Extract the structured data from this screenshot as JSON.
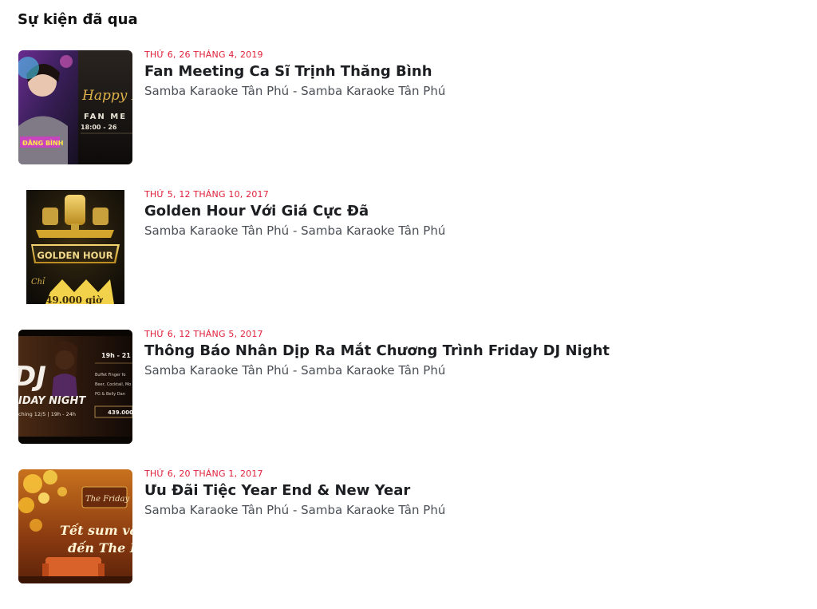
{
  "section": {
    "title": "Sự kiện đã qua"
  },
  "events": [
    {
      "date": "THỨ 6, 26 THÁNG 4, 2019",
      "title": "Fan Meeting Ca Sĩ Trịnh Thăng Bình",
      "location": "Samba Karaoke Tân Phú - Samba Karaoke Tân Phú",
      "thumb": {
        "line1": "Happy B",
        "line2": "FAN ME",
        "line3": "18:00 - 26",
        "tag": "ĐĂNG BÌNH"
      }
    },
    {
      "date": "THỨ 5, 12 THÁNG 10, 2017",
      "title": "Golden Hour Với Giá Cực Đã",
      "location": "Samba Karaoke Tân Phú - Samba Karaoke Tân Phú",
      "thumb": {
        "banner": "GOLDEN HOUR",
        "prefix": "Chỉ",
        "price": "49.000 giờ"
      }
    },
    {
      "date": "THỨ 6, 12 THÁNG 5, 2017",
      "title": "Thông Báo Nhân Dịp Ra Mắt Chương Trình Friday DJ Night",
      "location": "Samba Karaoke Tân Phú - Samba Karaoke Tân Phú",
      "thumb": {
        "big": "DJ",
        "line": "IDAY NIGHT",
        "time": "19h - 21",
        "sub": "ching 12/5 | 19h - 24h",
        "menu": [
          "Buffet Finger fo",
          "Beer, Cocktail, Mo",
          "PG & Belly Dan"
        ],
        "price": "439.000"
      }
    },
    {
      "date": "THỨ 6, 20 THÁNG 1, 2017",
      "title": "Ưu Đãi Tiệc Year End & New Year",
      "location": "Samba Karaoke Tân Phú - Samba Karaoke Tân Phú",
      "thumb": {
        "script1": "Tết sum vầ",
        "script2": "đến The F",
        "sign": "The Friday"
      }
    }
  ]
}
